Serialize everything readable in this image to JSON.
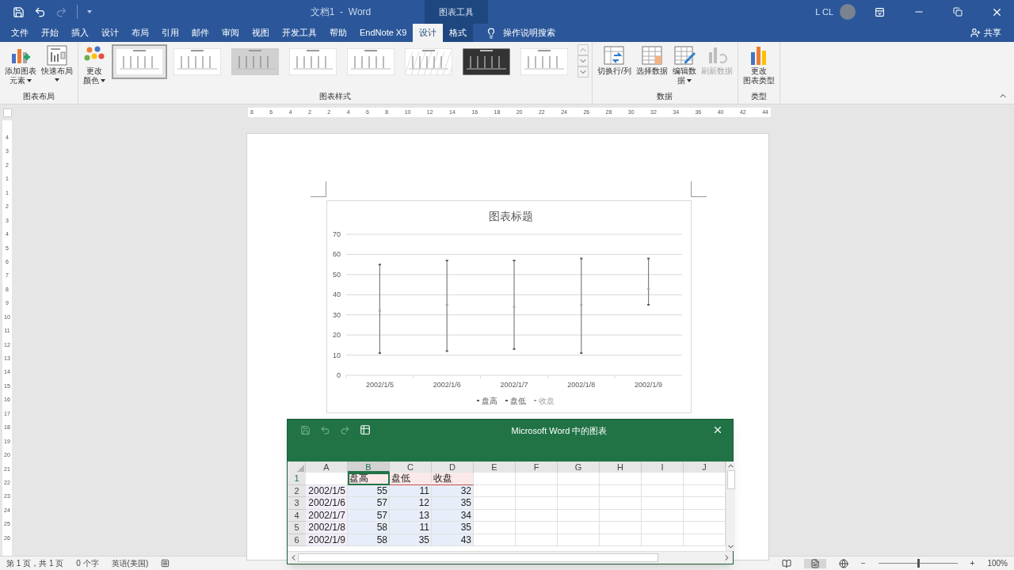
{
  "title_bar": {
    "title": "文档1  -  Word",
    "context_group": "图表工具",
    "user": "L CL",
    "quick_access": [
      {
        "kind": "save",
        "disabled": false
      },
      {
        "kind": "undo",
        "disabled": false
      },
      {
        "kind": "redo",
        "disabled": true
      }
    ]
  },
  "menu_tabs": [
    {
      "label": "文件",
      "selected": false,
      "contextual": false
    },
    {
      "label": "开始",
      "selected": false,
      "contextual": false
    },
    {
      "label": "插入",
      "selected": false,
      "contextual": false
    },
    {
      "label": "设计",
      "selected": false,
      "contextual": false
    },
    {
      "label": "布局",
      "selected": false,
      "contextual": false
    },
    {
      "label": "引用",
      "selected": false,
      "contextual": false
    },
    {
      "label": "邮件",
      "selected": false,
      "contextual": false
    },
    {
      "label": "审阅",
      "selected": false,
      "contextual": false
    },
    {
      "label": "视图",
      "selected": false,
      "contextual": false
    },
    {
      "label": "开发工具",
      "selected": false,
      "contextual": false
    },
    {
      "label": "帮助",
      "selected": false,
      "contextual": false
    },
    {
      "label": "EndNote X9",
      "selected": false,
      "contextual": false
    },
    {
      "label": "设计",
      "selected": true,
      "contextual": true
    },
    {
      "label": "格式",
      "selected": false,
      "contextual": true
    }
  ],
  "search": {
    "label": "操作说明搜索"
  },
  "share": {
    "label": "共享"
  },
  "ribbon": {
    "groups": [
      {
        "label": "图表布局",
        "items": [
          {
            "kind": "button",
            "lines": [
              "添加图表",
              "元素"
            ],
            "dropdown": true,
            "disabled": false
          },
          {
            "kind": "button",
            "lines": [
              "快速布局"
            ],
            "dropdown": true,
            "disabled": false
          }
        ]
      },
      {
        "label": "图表样式",
        "items": [
          {
            "kind": "button",
            "lines": [
              "更改",
              "颜色"
            ],
            "dropdown": true,
            "disabled": false
          },
          {
            "kind": "gallery",
            "styles": [
              {
                "kind": "light",
                "selected": true
              },
              {
                "kind": "light",
                "selected": false
              },
              {
                "kind": "gray",
                "selected": false
              },
              {
                "kind": "light",
                "selected": false
              },
              {
                "kind": "light",
                "selected": false
              },
              {
                "kind": "hatched",
                "selected": false
              },
              {
                "kind": "dark",
                "selected": false
              },
              {
                "kind": "light",
                "selected": false
              }
            ]
          }
        ]
      },
      {
        "label": "数据",
        "items": [
          {
            "kind": "button",
            "lines": [
              "切换行/列"
            ],
            "dropdown": false,
            "disabled": false
          },
          {
            "kind": "button",
            "lines": [
              "选择数据"
            ],
            "dropdown": false,
            "disabled": false
          },
          {
            "kind": "button",
            "lines": [
              "编辑数",
              "据"
            ],
            "dropdown": true,
            "disabled": false
          },
          {
            "kind": "button",
            "lines": [
              "刷新数据"
            ],
            "dropdown": false,
            "disabled": true
          }
        ]
      },
      {
        "label": "类型",
        "items": [
          {
            "kind": "button",
            "lines": [
              "更改",
              "图表类型"
            ],
            "dropdown": false,
            "disabled": false
          }
        ]
      }
    ]
  },
  "ruler": {
    "labels": [
      "8",
      "6",
      "4",
      "2",
      "2",
      "4",
      "6",
      "8",
      "10",
      "12",
      "14",
      "16",
      "18",
      "20",
      "22",
      "24",
      "26",
      "28",
      "30",
      "32",
      "34",
      "36",
      "40",
      "42",
      "44"
    ]
  },
  "vertical_ruler": {
    "labels": [
      "4",
      "3",
      "2",
      "1",
      "1",
      "2",
      "3",
      "4",
      "5",
      "6",
      "7",
      "8",
      "9",
      "10",
      "11",
      "12",
      "13",
      "14",
      "15",
      "16",
      "17",
      "18",
      "19",
      "20",
      "21",
      "22",
      "23",
      "24",
      "25",
      "26"
    ]
  },
  "chart": {
    "chart_data": {
      "type": "scatter",
      "title": "图表标题",
      "categories": [
        "2002/1/5",
        "2002/1/6",
        "2002/1/7",
        "2002/1/8",
        "2002/1/9"
      ],
      "ylim": [
        0,
        70
      ],
      "yticks": [
        0,
        10,
        20,
        30,
        40,
        50,
        60,
        70
      ],
      "grid": true,
      "legend": "bottom",
      "series": [
        {
          "name": "盘高",
          "color": "#595959",
          "values": [
            55,
            57,
            57,
            58,
            58
          ]
        },
        {
          "name": "盘低",
          "color": "#595959",
          "values": [
            11,
            12,
            13,
            11,
            35
          ]
        },
        {
          "name": "收盘",
          "color": "#a6a6a6",
          "values": [
            32,
            35,
            34,
            35,
            43
          ]
        }
      ]
    }
  },
  "sheet": {
    "title": "Microsoft Word 中的图表",
    "columns": [
      {
        "label": "A",
        "kind": "category",
        "selected": false
      },
      {
        "label": "B",
        "kind": "series",
        "selected": true
      },
      {
        "label": "C",
        "kind": "series",
        "selected": false
      },
      {
        "label": "D",
        "kind": "series",
        "selected": false
      },
      {
        "label": "E",
        "kind": "none",
        "selected": false
      },
      {
        "label": "F",
        "kind": "none",
        "selected": false
      },
      {
        "label": "G",
        "kind": "none",
        "selected": false
      },
      {
        "label": "H",
        "kind": "none",
        "selected": false
      },
      {
        "label": "I",
        "kind": "none",
        "selected": false
      },
      {
        "label": "J",
        "kind": "none",
        "selected": false
      }
    ],
    "rows": [
      {
        "number": "1",
        "kind": "header",
        "selected": true,
        "cells": [
          "",
          "盘高",
          "盘低",
          "收盘"
        ]
      },
      {
        "number": "2",
        "kind": "data",
        "selected": false,
        "cells": [
          "2002/1/5",
          "55",
          "11",
          "32"
        ]
      },
      {
        "number": "3",
        "kind": "data",
        "selected": false,
        "cells": [
          "2002/1/6",
          "57",
          "12",
          "35"
        ]
      },
      {
        "number": "4",
        "kind": "data",
        "selected": false,
        "cells": [
          "2002/1/7",
          "57",
          "13",
          "34"
        ]
      },
      {
        "number": "5",
        "kind": "data",
        "selected": false,
        "cells": [
          "2002/1/8",
          "58",
          "11",
          "35"
        ]
      },
      {
        "number": "6",
        "kind": "data",
        "selected": false,
        "cells": [
          "2002/1/9",
          "58",
          "35",
          "43"
        ]
      }
    ]
  },
  "status_bar": {
    "page": "第 1 页，共 1 页",
    "words": "0 个字",
    "language": "英语(美国)",
    "zoom_out": "−",
    "zoom_in": "+",
    "zoom": "100%",
    "zoom_slider": {
      "level": 0.5
    }
  }
}
